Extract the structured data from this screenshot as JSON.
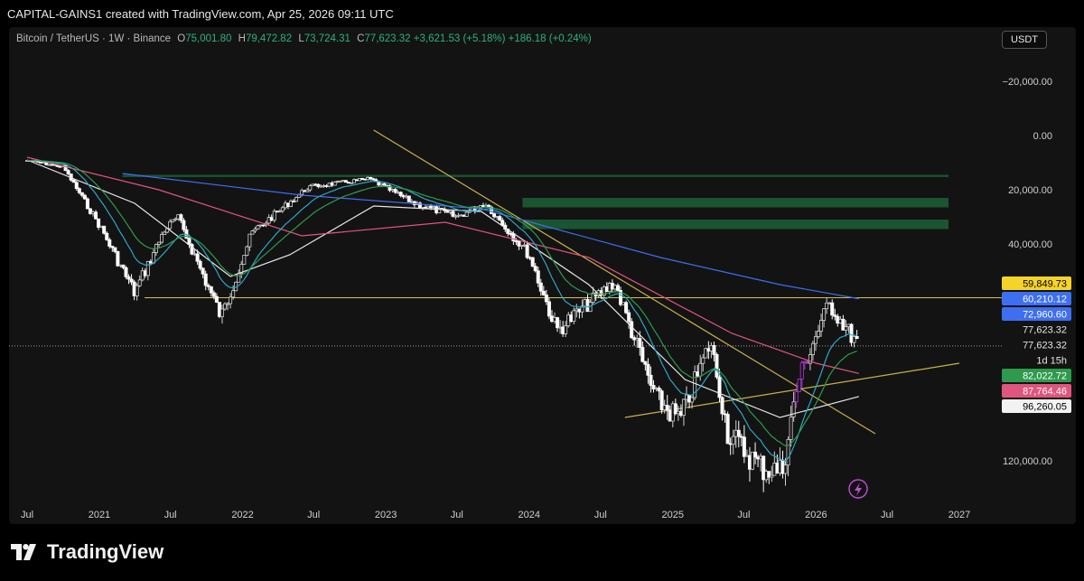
{
  "header": {
    "credit": "CAPITAL-GAINS1 created with TradingView.com, Apr 25, 2026 09:11 UTC"
  },
  "legend": {
    "symbol": "Bitcoin / TetherUS · 1W · Binance",
    "o_label": "O",
    "o_value": "75,001.80",
    "h_label": "H",
    "h_value": "79,472.82",
    "l_label": "L",
    "l_value": "73,724.31",
    "c_label": "C",
    "c_value": "77,623.32",
    "change": "+3,621.53 (+5.18%)",
    "volume": "+186.18 (+0.24%)"
  },
  "currency_button": "USDT",
  "brand": {
    "name": "TradingView",
    "icon": "tradingview-logo-icon"
  },
  "colors": {
    "up": "#ffffff",
    "down": "#d0d0d0",
    "ma_white": "#e8e8e8",
    "ma_pink": "#e0557f",
    "ma_blue": "#3e6ff0",
    "ma_green": "#2e9a4d",
    "ma_cyan": "#2aa7c9",
    "trend_yellow": "#c8b14a",
    "zone_green": "#1e6b3c",
    "highlight_purple": "#b03cd8",
    "lightning": "#c24dd6"
  },
  "chart_data": {
    "type": "candlestick",
    "y_axis_inverted": true,
    "ylim": [
      -25000,
      130000
    ],
    "y_ticks": [
      -20000,
      0,
      20000,
      40000,
      120000
    ],
    "y_tick_labels": [
      "−20,000.00",
      "0.00",
      "20,000.00",
      "40,000.00",
      "120,000.00"
    ],
    "x_tick_labels": [
      "Jul",
      "2021",
      "Jul",
      "2022",
      "Jul",
      "2023",
      "Jul",
      "2024",
      "Jul",
      "2025",
      "Jul",
      "2026",
      "Jul",
      "2027"
    ],
    "x_tick_dates": [
      "2020-07-01",
      "2021-01-01",
      "2021-07-01",
      "2022-01-01",
      "2022-07-01",
      "2023-01-01",
      "2023-07-01",
      "2024-01-01",
      "2024-07-01",
      "2025-01-01",
      "2025-07-01",
      "2026-01-01",
      "2026-07-01",
      "2027-01-01"
    ],
    "price_labels": [
      {
        "text": "59,849.73",
        "value": 59849.73,
        "bg": "#f5d328",
        "fg": "#000000"
      },
      {
        "text": "60,210.12",
        "value": 60210.12,
        "bg": "#3e6ff0",
        "fg": "#ffffff"
      },
      {
        "text": "72,960.60",
        "value": 72960.6,
        "bg": "#3e6ff0",
        "fg": "#ffffff"
      },
      {
        "text": "77,623.32",
        "value": 77623.32,
        "bg": "#131313",
        "fg": "#e6e6e6"
      },
      {
        "text": "77,623.32",
        "value": 77623.32,
        "bg": "#131313",
        "fg": "#e6e6e6"
      },
      {
        "text": "1d 15h",
        "value": null,
        "bg": "#131313",
        "fg": "#e6e6e6"
      },
      {
        "text": "82,022.72",
        "value": 82022.72,
        "bg": "#2e9a4d",
        "fg": "#ffffff"
      },
      {
        "text": "87,764.46",
        "value": 87764.46,
        "bg": "#e0557f",
        "fg": "#ffffff"
      },
      {
        "text": "96,260.05",
        "value": 96260.05,
        "bg": "#f2f2f2",
        "fg": "#000000"
      }
    ],
    "horizontal_line": 59849.73,
    "current_price": 77623.32,
    "series_close_approx": [
      [
        "2020-07-01",
        9200
      ],
      [
        "2020-10-01",
        11500
      ],
      [
        "2021-01-01",
        33000
      ],
      [
        "2021-04-01",
        58000
      ],
      [
        "2021-06-15",
        35000
      ],
      [
        "2021-07-20",
        30000
      ],
      [
        "2021-11-08",
        67000
      ],
      [
        "2022-01-24",
        36000
      ],
      [
        "2022-06-18",
        19000
      ],
      [
        "2022-11-21",
        16000
      ],
      [
        "2023-03-15",
        25000
      ],
      [
        "2023-07-01",
        30000
      ],
      [
        "2023-09-11",
        25000
      ],
      [
        "2024-01-01",
        44000
      ],
      [
        "2024-03-11",
        72000
      ],
      [
        "2024-08-05",
        54000
      ],
      [
        "2024-11-18",
        97000
      ],
      [
        "2025-01-20",
        105000
      ],
      [
        "2025-04-07",
        76000
      ],
      [
        "2025-05-22",
        110000
      ],
      [
        "2025-08-11",
        122000
      ],
      [
        "2025-10-06",
        124000
      ],
      [
        "2025-11-17",
        90000
      ],
      [
        "2026-02-02",
        62000
      ],
      [
        "2026-04-20",
        77623.32
      ]
    ],
    "moving_averages": [
      {
        "color": "#e8e8e8",
        "points": [
          [
            "2020-07-01",
            9000
          ],
          [
            "2021-04-01",
            25000
          ],
          [
            "2021-12-01",
            52000
          ],
          [
            "2022-05-01",
            44000
          ],
          [
            "2022-12-01",
            26000
          ],
          [
            "2023-09-01",
            28000
          ],
          [
            "2024-06-01",
            55000
          ],
          [
            "2025-02-01",
            90000
          ],
          [
            "2025-10-01",
            104000
          ],
          [
            "2026-04-20",
            96260
          ]
        ]
      },
      {
        "color": "#e0557f",
        "points": [
          [
            "2020-07-01",
            8000
          ],
          [
            "2021-06-01",
            20000
          ],
          [
            "2022-06-01",
            37000
          ],
          [
            "2023-06-01",
            32000
          ],
          [
            "2024-06-01",
            45000
          ],
          [
            "2025-06-01",
            73000
          ],
          [
            "2026-01-01",
            84000
          ],
          [
            "2026-04-20",
            87764
          ]
        ]
      },
      {
        "color": "#3e6ff0",
        "points": [
          [
            "2021-03-01",
            14000
          ],
          [
            "2022-06-01",
            22000
          ],
          [
            "2023-09-01",
            27000
          ],
          [
            "2024-12-01",
            45000
          ],
          [
            "2025-10-01",
            55000
          ],
          [
            "2026-04-20",
            60210
          ]
        ]
      }
    ],
    "trendlines": [
      {
        "from": [
          "2022-12-01",
          -2000
        ],
        "to": [
          "2026-06-01",
          110000
        ]
      },
      {
        "from": [
          "2024-09-01",
          104000
        ],
        "to": [
          "2027-01-01",
          84000
        ]
      }
    ],
    "zones": [
      {
        "from_date": "2021-03-01",
        "to_date": "2027-01-01",
        "low": 14500,
        "high": 15300
      },
      {
        "from_date": "2023-12-15",
        "to_date": "2027-01-01",
        "low": 23000,
        "high": 26500
      },
      {
        "from_date": "2023-12-15",
        "to_date": "2027-01-01",
        "low": 31000,
        "high": 34500
      }
    ]
  }
}
